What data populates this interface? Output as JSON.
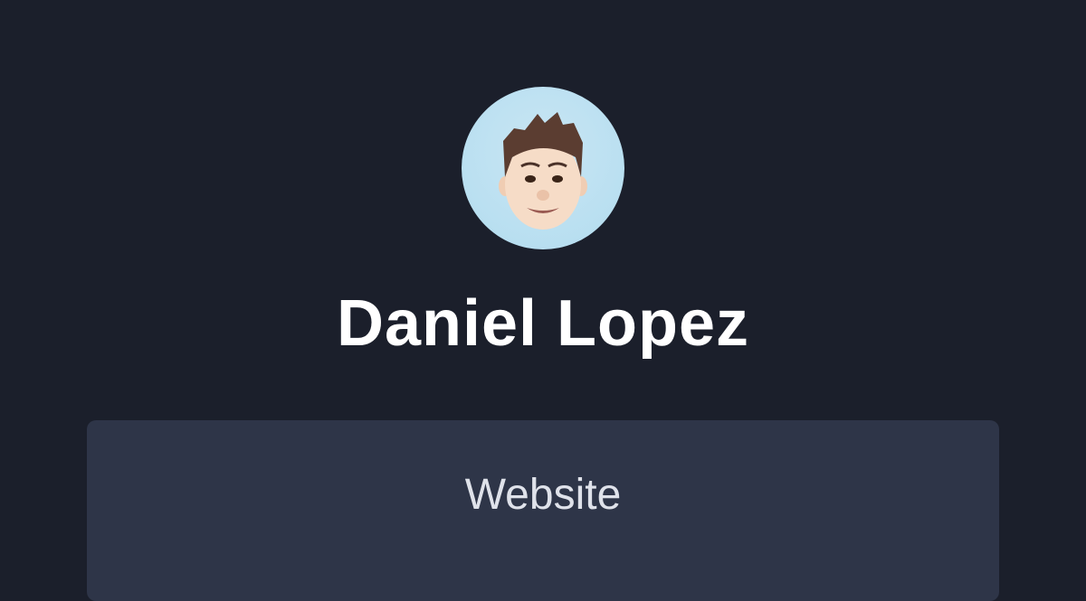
{
  "profile": {
    "name": "Daniel Lopez",
    "avatar": "memoji-avatar",
    "avatar_bg": "#b8dff0"
  },
  "links": [
    {
      "label": "Website"
    }
  ],
  "colors": {
    "background": "#1b1f2b",
    "card": "#2e3548",
    "text": "#ffffff"
  }
}
